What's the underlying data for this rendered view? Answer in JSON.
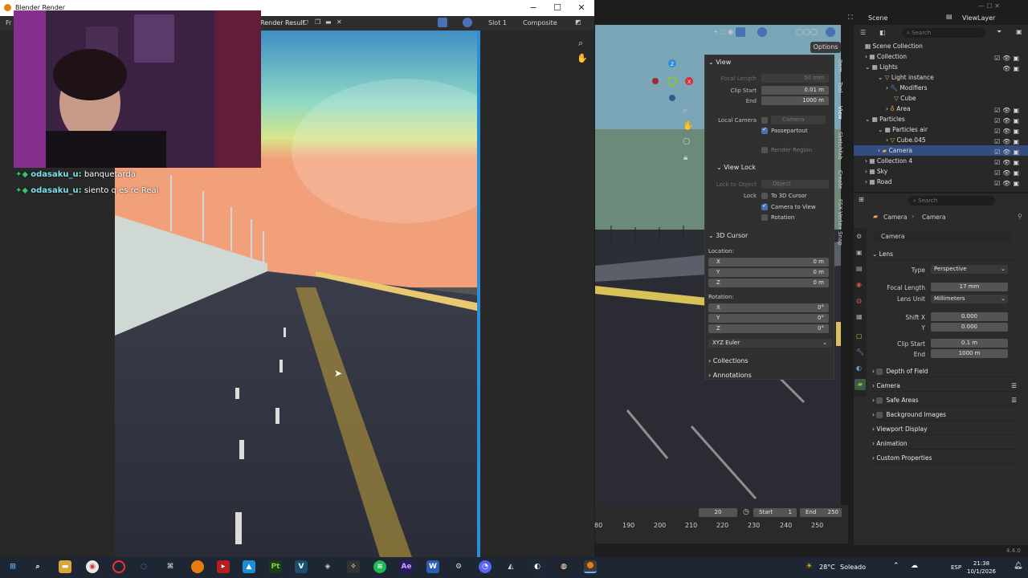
{
  "render_window": {
    "title": "Blender Render",
    "menu_stub": "Fr",
    "result_label": "Render Result",
    "slot_label": "Slot 1",
    "composite_label": "Composite"
  },
  "chat": [
    {
      "user": "odasaku_u:",
      "message": "banquetarda"
    },
    {
      "user": "odasaku_u:",
      "message": "siento q es re Real"
    }
  ],
  "viewport_header": {
    "scene_label": "Scene",
    "viewlayer_label": "ViewLayer",
    "options_label": "Options",
    "search_placeholder": "Search"
  },
  "npanel": {
    "view_title": "View",
    "focal_length_label": "Focal Length",
    "focal_length_value": "50 mm",
    "clip_start_label": "Clip Start",
    "clip_start_value": "0.01 m",
    "end_label": "End",
    "end_value": "1000 m",
    "local_camera_label": "Local Camera",
    "local_camera_value": "Camera",
    "passepartout_label": "Passepartout",
    "render_region_label": "Render Region",
    "view_lock_title": "View Lock",
    "lock_to_object_label": "Lock to Object",
    "lock_to_object_value": "Object",
    "lock_label": "Lock",
    "to_3d_cursor_label": "To 3D Cursor",
    "camera_to_view_label": "Camera to View",
    "rotation_chk_label": "Rotation",
    "cursor_title": "3D Cursor",
    "location_label": "Location:",
    "rotation_label": "Rotation:",
    "x_label": "X",
    "y_label": "Y",
    "z_label": "Z",
    "loc_x": "0 m",
    "loc_y": "0 m",
    "loc_z": "0 m",
    "rot_x": "0°",
    "rot_y": "0°",
    "rot_z": "0°",
    "rotation_mode": "XYZ Euler",
    "collections_label": "Collections",
    "annotations_label": "Annotations",
    "tabs": [
      "Item",
      "Tool",
      "View",
      "Sketchfab",
      "Create",
      "FSX Vertex Snap"
    ]
  },
  "timeline": {
    "current_frame": "20",
    "start_label": "Start",
    "start_value": "1",
    "end_label": "End",
    "end_value": "250",
    "ticks": [
      "80",
      "190",
      "200",
      "210",
      "220",
      "230",
      "240",
      "250"
    ]
  },
  "outliner": {
    "search_placeholder": "Search",
    "items": [
      {
        "label": "Scene Collection",
        "indent": 0
      },
      {
        "label": "Collection",
        "indent": 1
      },
      {
        "label": "Lights",
        "indent": 1
      },
      {
        "label": "Light instance",
        "indent": 2
      },
      {
        "label": "Modifiers",
        "indent": 3
      },
      {
        "label": "Cube",
        "indent": 3
      },
      {
        "label": "Area",
        "indent": 2
      },
      {
        "label": "Particles",
        "indent": 1
      },
      {
        "label": "Particles air",
        "indent": 2
      },
      {
        "label": "Cube.045",
        "indent": 3
      },
      {
        "label": "Camera",
        "indent": 2,
        "selected": true
      },
      {
        "label": "Collection 4",
        "indent": 1
      },
      {
        "label": "Sky",
        "indent": 1
      },
      {
        "label": "Road",
        "indent": 1
      }
    ]
  },
  "properties": {
    "search_placeholder": "Search",
    "breadcrumb_object": "Camera",
    "breadcrumb_data": "Camera",
    "datablock_name": "Camera",
    "lens_title": "Lens",
    "type_label": "Type",
    "type_value": "Perspective",
    "focal_length_label": "Focal Length",
    "focal_length_value": "17 mm",
    "lens_unit_label": "Lens Unit",
    "lens_unit_value": "Millimeters",
    "shift_x_label": "Shift X",
    "shift_x_value": "0.000",
    "shift_y_label": "Y",
    "shift_y_value": "0.000",
    "clip_start_label": "Clip Start",
    "clip_start_value": "0.1 m",
    "clip_end_label": "End",
    "clip_end_value": "1000 m",
    "panels": [
      "Depth of Field",
      "Camera",
      "Safe Areas",
      "Background Images",
      "Viewport Display",
      "Animation",
      "Custom Properties"
    ]
  },
  "version": "4.4.0",
  "taskbar": {
    "weather_temp": "28°C",
    "weather_text": "Soleado",
    "language": "ESP",
    "time": "21:38",
    "date": "10/1/2026"
  },
  "colors": {
    "accent": "#4772b3",
    "selection": "#334d80",
    "taskbar": "#1f2633"
  }
}
